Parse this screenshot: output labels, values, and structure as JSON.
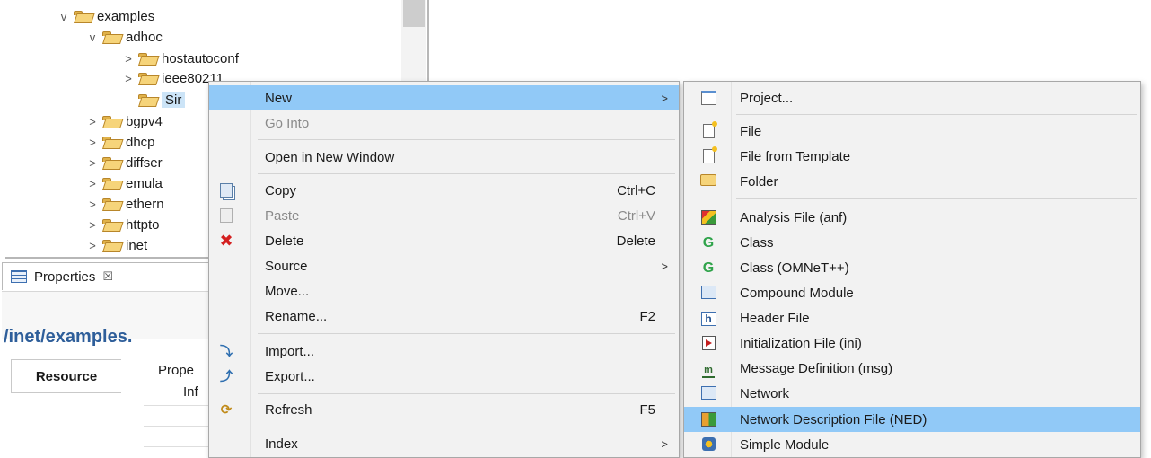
{
  "tree": {
    "items": [
      {
        "label": "examples",
        "chevron": "v",
        "level": 3,
        "selected": false
      },
      {
        "label": "adhoc",
        "chevron": "v",
        "level": 4,
        "selected": false
      },
      {
        "label": "hostautoconf",
        "chevron": ">",
        "level": 5,
        "selected": false
      },
      {
        "label": "ieee80211",
        "chevron": ">",
        "level": 5,
        "selected": false
      },
      {
        "label": "Sir",
        "chevron": "",
        "level": 5,
        "selected": true
      },
      {
        "label": "bgpv4",
        "chevron": ">",
        "level": 4,
        "selected": false
      },
      {
        "label": "dhcp",
        "chevron": ">",
        "level": 4,
        "selected": false
      },
      {
        "label": "diffser",
        "chevron": ">",
        "level": 4,
        "selected": false
      },
      {
        "label": "emula",
        "chevron": ">",
        "level": 4,
        "selected": false
      },
      {
        "label": "ethern",
        "chevron": ">",
        "level": 4,
        "selected": false
      },
      {
        "label": "httpto",
        "chevron": ">",
        "level": 4,
        "selected": false
      },
      {
        "label": "inet",
        "chevron": ">",
        "level": 4,
        "selected": false
      }
    ]
  },
  "properties": {
    "tab_label": "Properties",
    "tab_close": "☒",
    "path_title": "/inet/examples.",
    "resource_tab": "Resource",
    "column_label": "Prope",
    "info_label": "Inf"
  },
  "context_menu": {
    "items": [
      {
        "label": "New",
        "shortcut": "",
        "submenu": true,
        "highlighted": true,
        "disabled": false,
        "icon": ""
      },
      {
        "label": "Go Into",
        "shortcut": "",
        "submenu": false,
        "highlighted": false,
        "disabled": true,
        "icon": ""
      },
      {
        "label": "Open in New Window",
        "shortcut": "",
        "submenu": false,
        "highlighted": false,
        "disabled": false,
        "icon": ""
      },
      {
        "label": "Copy",
        "shortcut": "Ctrl+C",
        "submenu": false,
        "highlighted": false,
        "disabled": false,
        "icon": "copy-icon"
      },
      {
        "label": "Paste",
        "shortcut": "Ctrl+V",
        "submenu": false,
        "highlighted": false,
        "disabled": true,
        "icon": "paste-icon"
      },
      {
        "label": "Delete",
        "shortcut": "Delete",
        "submenu": false,
        "highlighted": false,
        "disabled": false,
        "icon": "delete-icon"
      },
      {
        "label": "Source",
        "shortcut": "",
        "submenu": true,
        "highlighted": false,
        "disabled": false,
        "icon": ""
      },
      {
        "label": "Move...",
        "shortcut": "",
        "submenu": false,
        "highlighted": false,
        "disabled": false,
        "icon": ""
      },
      {
        "label": "Rename...",
        "shortcut": "F2",
        "submenu": false,
        "highlighted": false,
        "disabled": false,
        "icon": ""
      },
      {
        "label": "Import...",
        "shortcut": "",
        "submenu": false,
        "highlighted": false,
        "disabled": false,
        "icon": "import-icon"
      },
      {
        "label": "Export...",
        "shortcut": "",
        "submenu": false,
        "highlighted": false,
        "disabled": false,
        "icon": "export-icon"
      },
      {
        "label": "Refresh",
        "shortcut": "F5",
        "submenu": false,
        "highlighted": false,
        "disabled": false,
        "icon": "refresh-icon"
      },
      {
        "label": "Index",
        "shortcut": "",
        "submenu": true,
        "highlighted": false,
        "disabled": false,
        "icon": ""
      }
    ],
    "arrow_glyph": ">"
  },
  "submenu": {
    "items": [
      {
        "label": "Project...",
        "icon": "project-icon",
        "highlighted": false
      },
      {
        "label": "File",
        "icon": "file-icon",
        "highlighted": false
      },
      {
        "label": "File from Template",
        "icon": "file-template-icon",
        "highlighted": false
      },
      {
        "label": "Folder",
        "icon": "folder-icon",
        "highlighted": false
      },
      {
        "label": "Analysis File (anf)",
        "icon": "analysis-file-icon",
        "highlighted": false
      },
      {
        "label": "Class",
        "icon": "class-icon",
        "highlighted": false
      },
      {
        "label": "Class (OMNeT++)",
        "icon": "omnet-class-icon",
        "highlighted": false
      },
      {
        "label": "Compound Module",
        "icon": "compound-module-icon",
        "highlighted": false
      },
      {
        "label": "Header File",
        "icon": "header-file-icon",
        "highlighted": false
      },
      {
        "label": "Initialization File (ini)",
        "icon": "ini-file-icon",
        "highlighted": false
      },
      {
        "label": "Message Definition (msg)",
        "icon": "msg-definition-icon",
        "highlighted": false
      },
      {
        "label": "Network",
        "icon": "network-icon",
        "highlighted": false
      },
      {
        "label": "Network Description File (NED)",
        "icon": "ned-file-icon",
        "highlighted": true
      },
      {
        "label": "Simple Module",
        "icon": "simple-module-icon",
        "highlighted": false
      }
    ]
  },
  "colors": {
    "highlight": "#91c9f7",
    "menu_bg": "#f2f2f2",
    "title_blue": "#2e5e9a"
  }
}
